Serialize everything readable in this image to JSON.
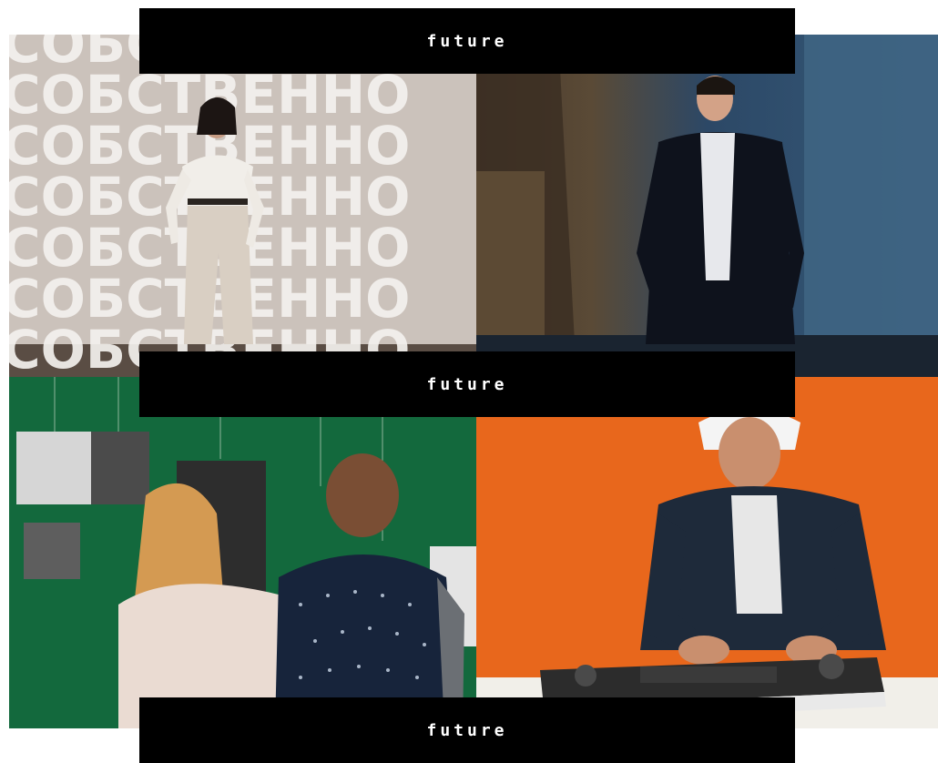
{
  "banners": [
    {
      "label": "future"
    },
    {
      "label": "future"
    },
    {
      "label": "future"
    }
  ],
  "projection_text": "СОБСТВЕННО",
  "colors": {
    "banner_bg": "#000000",
    "banner_text": "#ffffff",
    "green_wall": "#13693d",
    "orange_wall": "#e8671c",
    "projection_bg": "#c6bcb5",
    "stage_bg": "#2e4660"
  }
}
